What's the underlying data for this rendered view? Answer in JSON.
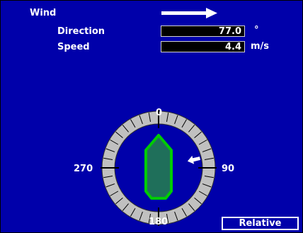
{
  "wind": {
    "title": "Wind",
    "direction_label": "Direction",
    "direction_value": "77.0",
    "direction_unit": "°",
    "speed_label": "Speed",
    "speed_value": "4.4",
    "speed_unit": "m/s"
  },
  "dial": {
    "north_label": "0",
    "east_label": "90",
    "south_label": "180",
    "west_label": "270",
    "wind_angle_deg": 77.0
  },
  "mode_button": {
    "label": "Relative"
  },
  "colors": {
    "background": "#0000aa",
    "dial_ring": "#c0c0c0",
    "vessel_fill": "#1f6f5a",
    "vessel_outline": "#00cc00"
  },
  "icons": {
    "wind_direction": "arrow-right-icon",
    "wind_indicator": "wind-arrow-icon",
    "vessel": "vessel-icon"
  }
}
